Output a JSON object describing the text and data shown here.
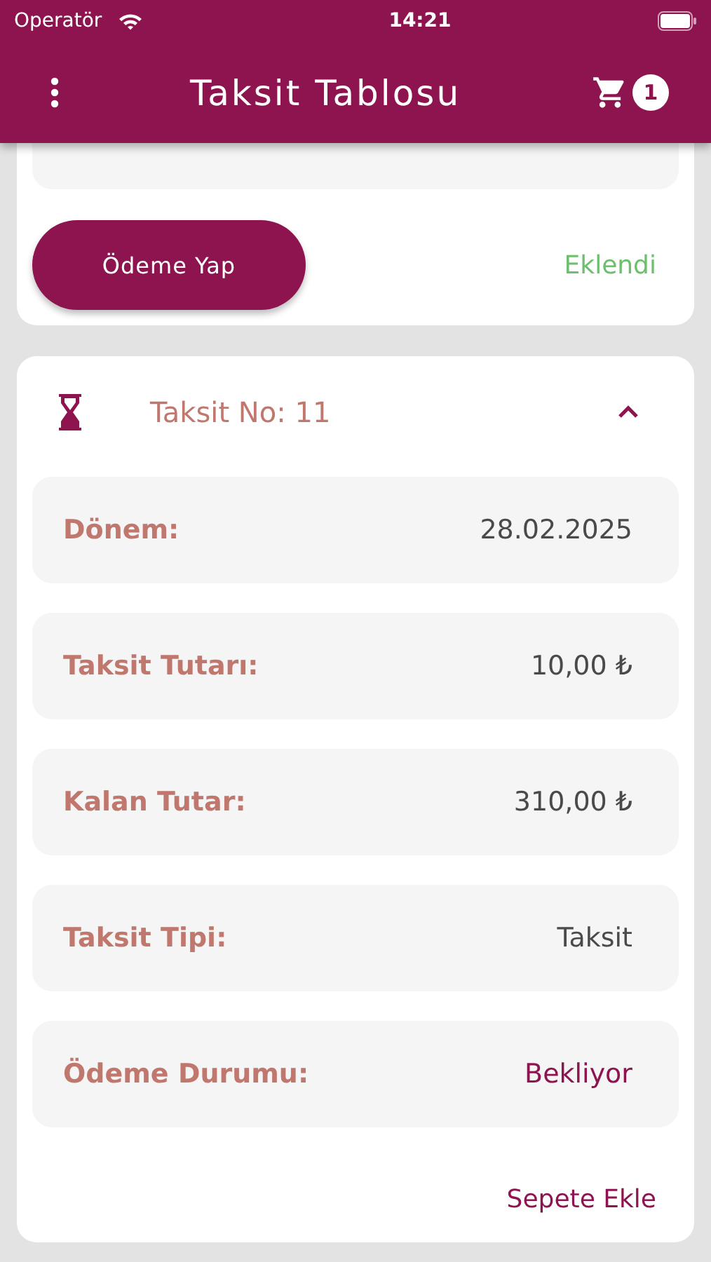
{
  "status_bar": {
    "carrier": "Operatör",
    "time": "14:21"
  },
  "header": {
    "title": "Taksit Tablosu",
    "cart_count": "1"
  },
  "previous_card": {
    "pay_button": "Ödeme Yap",
    "cart_status": "Eklendi"
  },
  "installment": {
    "title": "Taksit No: 11",
    "expanded": true,
    "rows": [
      {
        "label": "Dönem:",
        "value": "28.02.2025",
        "kind": "text"
      },
      {
        "label": "Taksit Tutarı:",
        "value": "10,00 ₺",
        "kind": "text"
      },
      {
        "label": "Kalan Tutar:",
        "value": "310,00 ₺",
        "kind": "text"
      },
      {
        "label": "Taksit Tipi:",
        "value": "Taksit",
        "kind": "text"
      },
      {
        "label": "Ödeme Durumu:",
        "value": "Bekliyor",
        "kind": "status"
      }
    ],
    "add_to_cart": "Sepete Ekle"
  }
}
